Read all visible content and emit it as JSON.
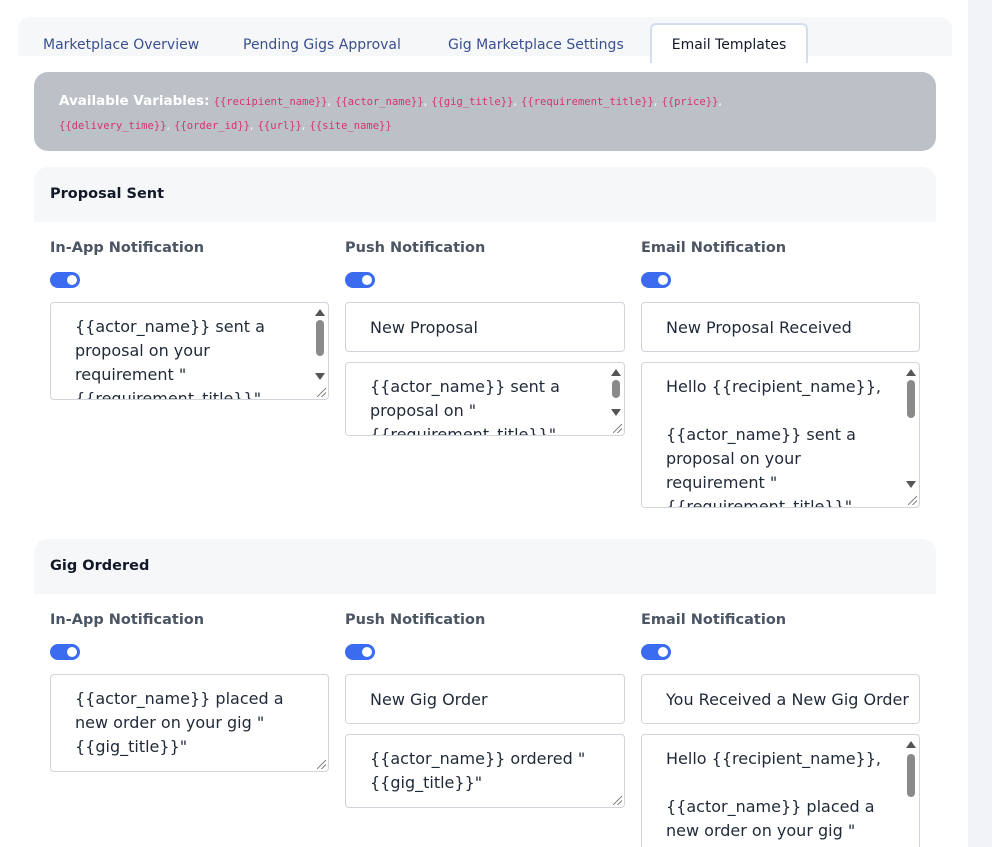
{
  "tabs": [
    {
      "label": "Marketplace Overview"
    },
    {
      "label": "Pending Gigs Approval"
    },
    {
      "label": "Gig Marketplace Settings"
    },
    {
      "label": "Email Templates"
    }
  ],
  "variables": {
    "heading": "Available Variables:",
    "tokens": [
      "{{recipient_name}}",
      "{{actor_name}}",
      "{{gig_title}}",
      "{{requirement_title}}",
      "{{price}}",
      "{{delivery_time}}",
      "{{order_id}}",
      "{{url}}",
      "{{site_name}}"
    ],
    "separator": ","
  },
  "sections": [
    {
      "title": "Proposal Sent",
      "in_app": {
        "label": "In-App Notification",
        "enabled": true,
        "body": "{{actor_name}} sent a proposal on your requirement \"{{requirement_title}}\""
      },
      "push": {
        "label": "Push Notification",
        "enabled": true,
        "title": "New Proposal",
        "body": "{{actor_name}} sent a proposal on \"{{requirement_title}}\""
      },
      "email": {
        "label": "Email Notification",
        "enabled": true,
        "subject": "New Proposal Received",
        "body": "Hello {{recipient_name}},\n\n{{actor_name}} sent a proposal on your requirement \"{{requirement_title}}\""
      }
    },
    {
      "title": "Gig Ordered",
      "in_app": {
        "label": "In-App Notification",
        "enabled": true,
        "body": "{{actor_name}} placed a new order on your gig \"{{gig_title}}\""
      },
      "push": {
        "label": "Push Notification",
        "enabled": true,
        "title": "New Gig Order",
        "body": "{{actor_name}} ordered \"{{gig_title}}\""
      },
      "email": {
        "label": "Email Notification",
        "enabled": true,
        "subject": "You Received a New Gig Order",
        "body": "Hello {{recipient_name}},\n\n{{actor_name}} placed a new order on your gig \""
      }
    }
  ]
}
